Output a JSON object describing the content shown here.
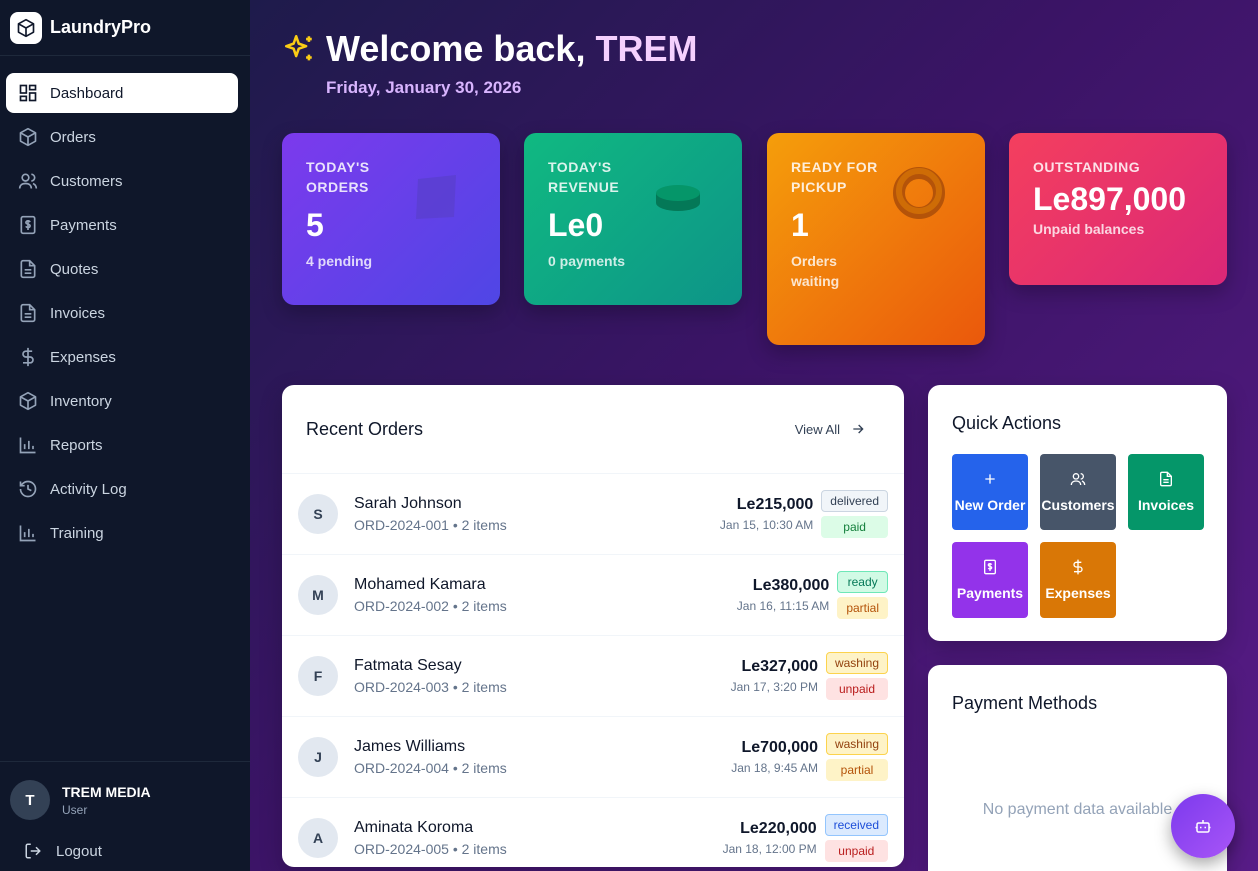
{
  "brand": {
    "name": "LaundryPro"
  },
  "sidebar": {
    "items": [
      {
        "label": "Dashboard",
        "icon": "dashboard-icon",
        "active": true
      },
      {
        "label": "Orders",
        "icon": "box-icon"
      },
      {
        "label": "Customers",
        "icon": "users-icon"
      },
      {
        "label": "Payments",
        "icon": "receipt-dollar-icon"
      },
      {
        "label": "Quotes",
        "icon": "document-icon"
      },
      {
        "label": "Invoices",
        "icon": "document-icon"
      },
      {
        "label": "Expenses",
        "icon": "dollar-icon"
      },
      {
        "label": "Inventory",
        "icon": "box-icon"
      },
      {
        "label": "Reports",
        "icon": "bar-chart-icon"
      },
      {
        "label": "Activity Log",
        "icon": "history-icon"
      },
      {
        "label": "Training",
        "icon": "bar-chart-icon"
      }
    ]
  },
  "user": {
    "initial": "T",
    "name": "TREM MEDIA",
    "role": "User",
    "logout": "Logout"
  },
  "header": {
    "welcome_prefix": "Welcome back, ",
    "username": "TREM",
    "date": "Friday, January 30, 2026"
  },
  "stats": {
    "orders": {
      "label": "TODAY'S ORDERS",
      "value": "5",
      "sub": "4 pending"
    },
    "revenue": {
      "label": "TODAY'S REVENUE",
      "value": "Le0",
      "sub": "0 payments"
    },
    "pickup": {
      "label": "READY FOR PICKUP",
      "value": "1",
      "sub": "Orders waiting"
    },
    "outstanding": {
      "label": "OUTSTANDING",
      "value": "Le897,000",
      "sub": "Unpaid balances"
    }
  },
  "recent_orders": {
    "title": "Recent Orders",
    "view_all": "View All",
    "rows": [
      {
        "initial": "S",
        "name": "Sarah Johnson",
        "meta": "ORD-2024-001 • 2 items",
        "amount": "Le215,000",
        "date": "Jan 15, 10:30 AM",
        "status": "delivered",
        "payment": "paid"
      },
      {
        "initial": "M",
        "name": "Mohamed Kamara",
        "meta": "ORD-2024-002 • 2 items",
        "amount": "Le380,000",
        "date": "Jan 16, 11:15 AM",
        "status": "ready",
        "payment": "partial"
      },
      {
        "initial": "F",
        "name": "Fatmata Sesay",
        "meta": "ORD-2024-003 • 2 items",
        "amount": "Le327,000",
        "date": "Jan 17, 3:20 PM",
        "status": "washing",
        "payment": "unpaid"
      },
      {
        "initial": "J",
        "name": "James Williams",
        "meta": "ORD-2024-004 • 2 items",
        "amount": "Le700,000",
        "date": "Jan 18, 9:45 AM",
        "status": "washing",
        "payment": "partial"
      },
      {
        "initial": "A",
        "name": "Aminata Koroma",
        "meta": "ORD-2024-005 • 2 items",
        "amount": "Le220,000",
        "date": "Jan 18, 12:00 PM",
        "status": "received",
        "payment": "unpaid"
      }
    ]
  },
  "quick_actions": {
    "title": "Quick Actions",
    "buttons": [
      {
        "label": "New Order",
        "icon": "plus-icon",
        "color": "#2563eb"
      },
      {
        "label": "Customers",
        "icon": "users-icon",
        "color": "#475569"
      },
      {
        "label": "Invoices",
        "icon": "document-icon",
        "color": "#059669"
      },
      {
        "label": "Payments",
        "icon": "receipt-dollar-icon",
        "color": "#9333ea"
      },
      {
        "label": "Expenses",
        "icon": "dollar-icon",
        "color": "#d97706"
      }
    ]
  },
  "payment_methods": {
    "title": "Payment Methods",
    "empty": "No payment data available"
  },
  "fab": {
    "icon": "robot-icon"
  }
}
